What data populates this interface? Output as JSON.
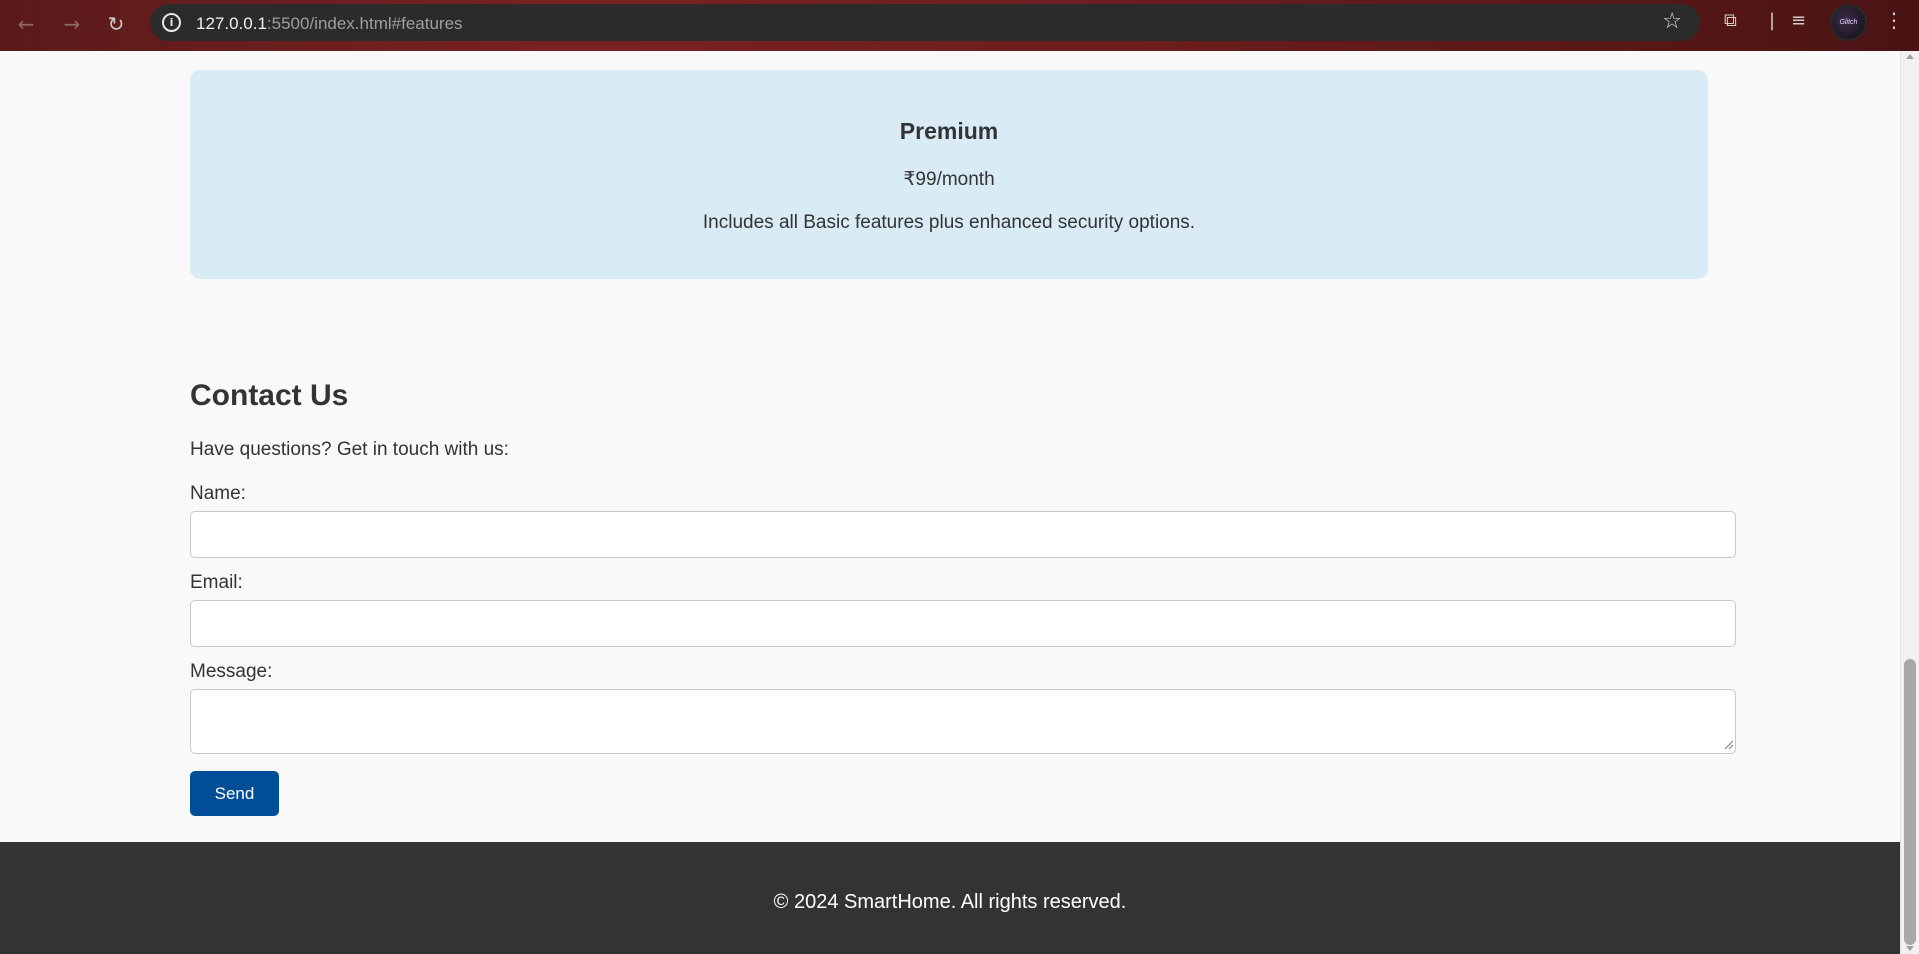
{
  "browser": {
    "url_host": "127.0.0.1",
    "url_rest": ":5500/index.html#features",
    "back_icon": "arrow-left-icon",
    "forward_icon": "arrow-right-icon",
    "reload_icon": "reload-icon",
    "info_icon": "info-icon",
    "info_glyph": "i",
    "bookmark_icon": "star-icon",
    "extensions_icon": "puzzle-icon",
    "media_icon": "media-queue-icon",
    "menu_icon": "kebab-menu-icon",
    "profile_label": "Glitch"
  },
  "plan": {
    "title": "Premium",
    "price": "₹99/month",
    "description": "Includes all Basic features plus enhanced security options."
  },
  "contact": {
    "title": "Contact Us",
    "intro": "Have questions? Get in touch with us:",
    "name_label": "Name:",
    "name_value": "",
    "email_label": "Email:",
    "email_value": "",
    "message_label": "Message:",
    "message_value": "",
    "send_label": "Send"
  },
  "footer": {
    "text": "© 2024 SmartHome. All rights reserved."
  },
  "colors": {
    "card_bg": "#d9ecf5",
    "button_bg": "#004e98",
    "footer_bg": "#333333",
    "page_bg": "#f9f9f9"
  }
}
